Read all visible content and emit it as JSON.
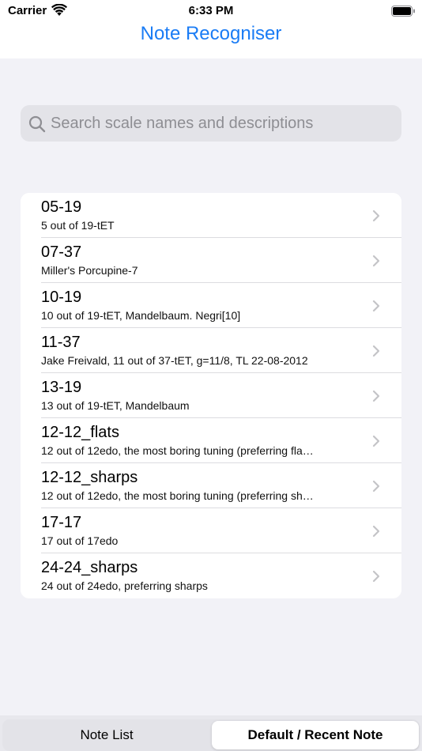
{
  "status_bar": {
    "carrier": "Carrier",
    "time": "6:33 PM",
    "wifi_icon": "wifi-icon",
    "battery_icon": "battery-full-icon"
  },
  "nav": {
    "title": "Note Recogniser",
    "title_color": "#1a7cf5"
  },
  "search": {
    "placeholder": "Search scale names and descriptions",
    "value": "",
    "icon": "search-icon"
  },
  "scales": [
    {
      "title": "05-19",
      "subtitle": "5 out of 19-tET"
    },
    {
      "title": "07-37",
      "subtitle": "Miller's Porcupine-7"
    },
    {
      "title": "10-19",
      "subtitle": "10 out of 19-tET, Mandelbaum. Negri[10]"
    },
    {
      "title": "11-37",
      "subtitle": "Jake Freivald, 11 out of 37-tET, g=11/8, TL 22-08-2012"
    },
    {
      "title": "13-19",
      "subtitle": "13 out of 19-tET, Mandelbaum"
    },
    {
      "title": "12-12_flats",
      "subtitle": "12 out of 12edo, the most boring tuning (preferring fla…"
    },
    {
      "title": "12-12_sharps",
      "subtitle": "12 out of 12edo, the most boring tuning (preferring sh…"
    },
    {
      "title": "17-17",
      "subtitle": "17 out of 17edo"
    },
    {
      "title": "24-24_sharps",
      "subtitle": "24 out of 24edo, preferring sharps"
    }
  ],
  "tabs": [
    {
      "label": "Note List",
      "selected": false
    },
    {
      "label": "Default / Recent Note",
      "selected": true
    }
  ],
  "colors": {
    "background": "#f2f2f7",
    "separator": "#dcdce0",
    "chevron": "#c4c4c7"
  }
}
